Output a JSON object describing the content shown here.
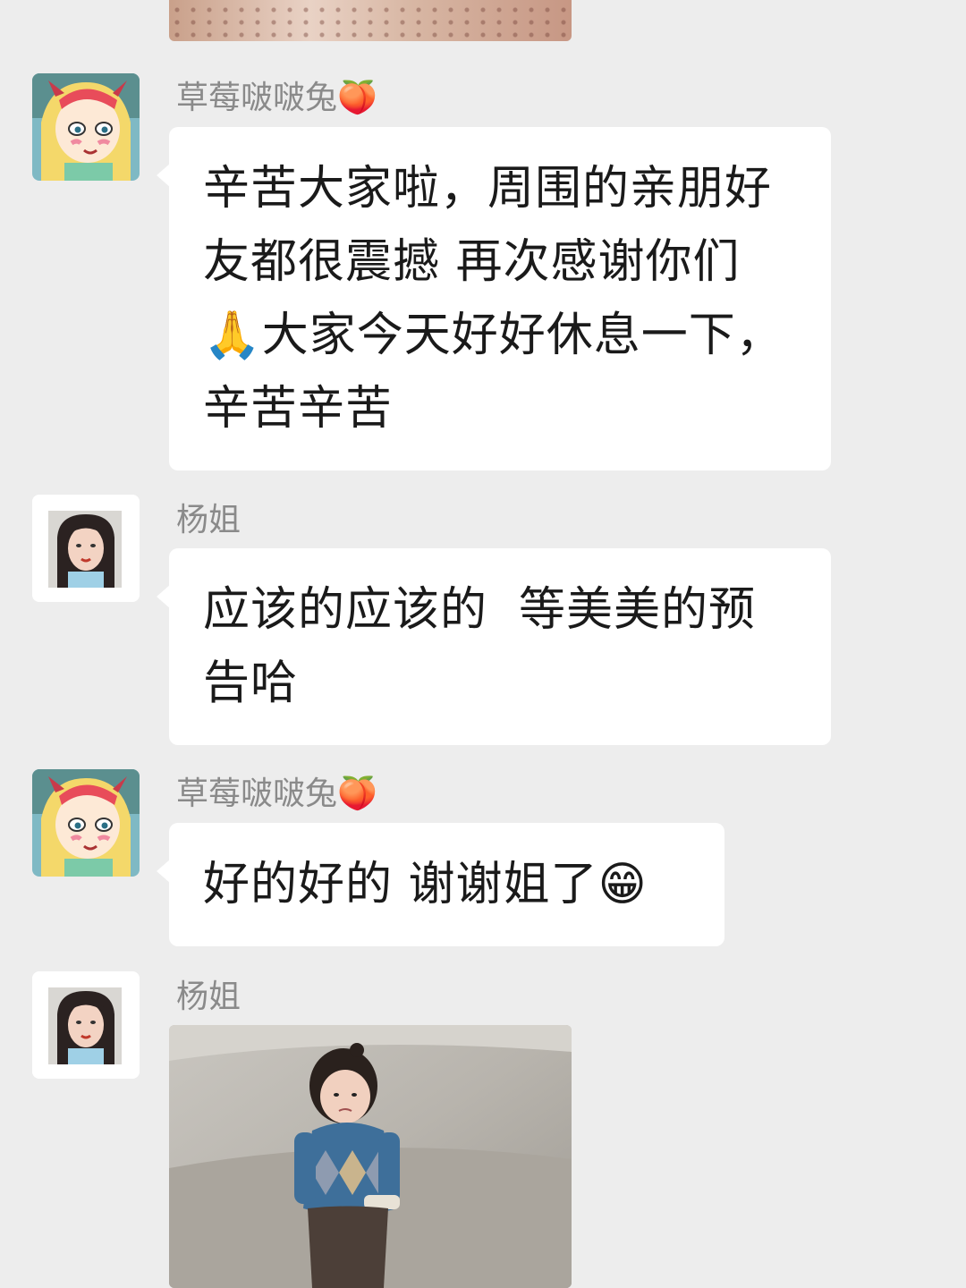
{
  "messages": [
    {
      "sender": "草莓啵啵兔",
      "sender_emoji": "🍑",
      "text": "辛苦大家啦，周围的亲朋好友都很震撼 再次感谢你们🙏大家今天好好休息一下，辛苦辛苦"
    },
    {
      "sender": "杨姐",
      "text": "应该的应该的  等美美的预告哈"
    },
    {
      "sender": "草莓啵啵兔",
      "sender_emoji": "🍑",
      "text": "好的好的 谢谢姐了😁"
    },
    {
      "sender": "杨姐"
    }
  ],
  "colors": {
    "background": "#ededed",
    "bubble": "#ffffff",
    "sender_name": "#8a8a8a"
  },
  "icons": {
    "avatar_1": "cartoon-girl-avatar",
    "avatar_2": "woman-photo-avatar"
  }
}
